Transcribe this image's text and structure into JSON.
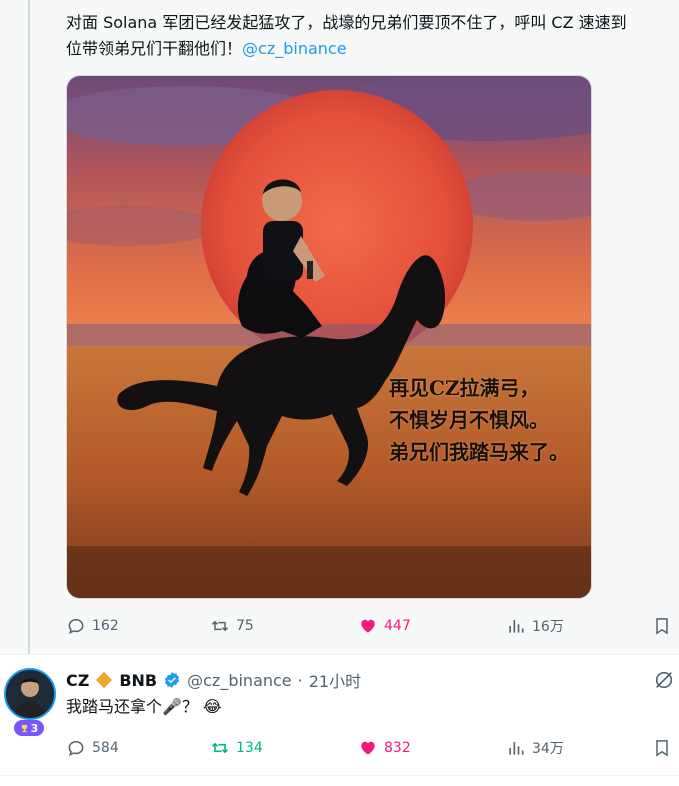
{
  "tweet1": {
    "text": "对面 Solana 军团已经发起猛攻了，战壕的兄弟们要顶不住了，呼叫 CZ 速速到\n位带领弟兄们干翻他们！",
    "mention": "@cz_binance",
    "image_caption": [
      "再见CZ拉满弓，",
      "不惧岁月不惧风。",
      "弟兄们我踏马来了。"
    ],
    "stats": {
      "replies": "162",
      "retweets": "75",
      "likes": "447",
      "views": "16万"
    }
  },
  "tweet2": {
    "name": "CZ",
    "name_suffix": "BNB",
    "handle": "@cz_binance",
    "separator": "·",
    "time": "21小时",
    "text": "我踏马还拿个",
    "text_tail": "？",
    "emoji_mic": "🎤",
    "emoji_laugh": "😂",
    "badge_count": "3",
    "stats": {
      "replies": "584",
      "retweets": "134",
      "likes": "832",
      "views": "34万"
    }
  },
  "colors": {
    "accent": "#1d9bf0",
    "like": "#f91880",
    "retweet_active": "#00ba7c",
    "muted": "#536471",
    "badge": "#7856ff"
  },
  "icons": [
    "reply-icon",
    "retweet-icon",
    "like-icon",
    "views-icon",
    "bookmark-icon",
    "verified-icon",
    "diamond-icon",
    "grok-icon",
    "trophy-icon"
  ]
}
